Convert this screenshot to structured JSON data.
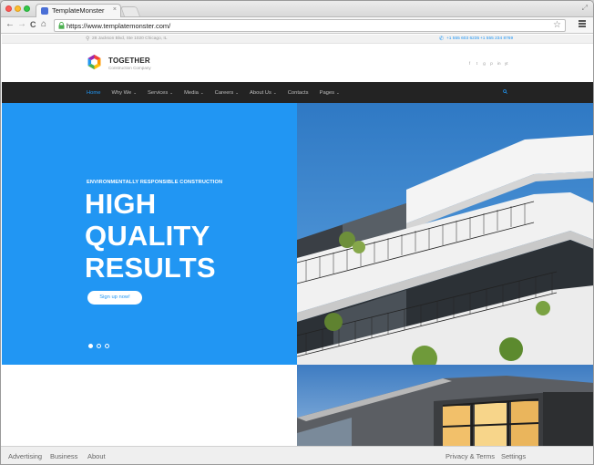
{
  "browser": {
    "tab_title": "TemplateMonster",
    "tab_close": "×",
    "url": "https://www.templatemonster.com/",
    "back": "←",
    "forward": "→",
    "reload": "C",
    "home": "⌂",
    "star": "☆",
    "resize": "⤢"
  },
  "site": {
    "topbar": {
      "address": "28 Jackson Blvd, Ste 1020 Chicago, IL",
      "phone_1": "+1 555 603 6235",
      "phone_2": "+1 555 234 8769"
    },
    "logo": {
      "name": "TOGETHER",
      "tagline": "Construction Company"
    },
    "social_icons": [
      "f",
      "t",
      "g",
      "p",
      "in",
      "yt"
    ],
    "nav": [
      {
        "label": "Home",
        "caret": "",
        "active": true
      },
      {
        "label": "Why We",
        "caret": "⌄",
        "active": false
      },
      {
        "label": "Services",
        "caret": "⌄",
        "active": false
      },
      {
        "label": "Media",
        "caret": "⌄",
        "active": false
      },
      {
        "label": "Careers",
        "caret": "⌄",
        "active": false
      },
      {
        "label": "About Us",
        "caret": "⌄",
        "active": false
      },
      {
        "label": "Contacts",
        "caret": "",
        "active": false
      },
      {
        "label": "Pages",
        "caret": "⌄",
        "active": false
      }
    ],
    "hero": {
      "eyebrow": "ENVIRONMENTALLY RESPONSIBLE CONSTRUCTION",
      "title": "HIGH\nQUALITY\nRESULTS",
      "button": "Sign up now!",
      "slides": 3,
      "active_slide": 1
    }
  },
  "footer": {
    "advertising": "Advertising",
    "business": "Business",
    "about": "About",
    "privacy": "Privacy & Terms",
    "settings": "Settings"
  },
  "colors": {
    "accent": "#2196f3",
    "nav_bg": "#232323"
  },
  "icons": {
    "back": "arrow-left-icon",
    "forward": "arrow-right-icon",
    "reload": "reload-icon",
    "home": "home-icon",
    "lock": "lock-icon",
    "star": "star-icon",
    "menu": "hamburger-icon",
    "search": "search-icon",
    "pin": "map-pin-icon",
    "phone": "phone-icon"
  }
}
